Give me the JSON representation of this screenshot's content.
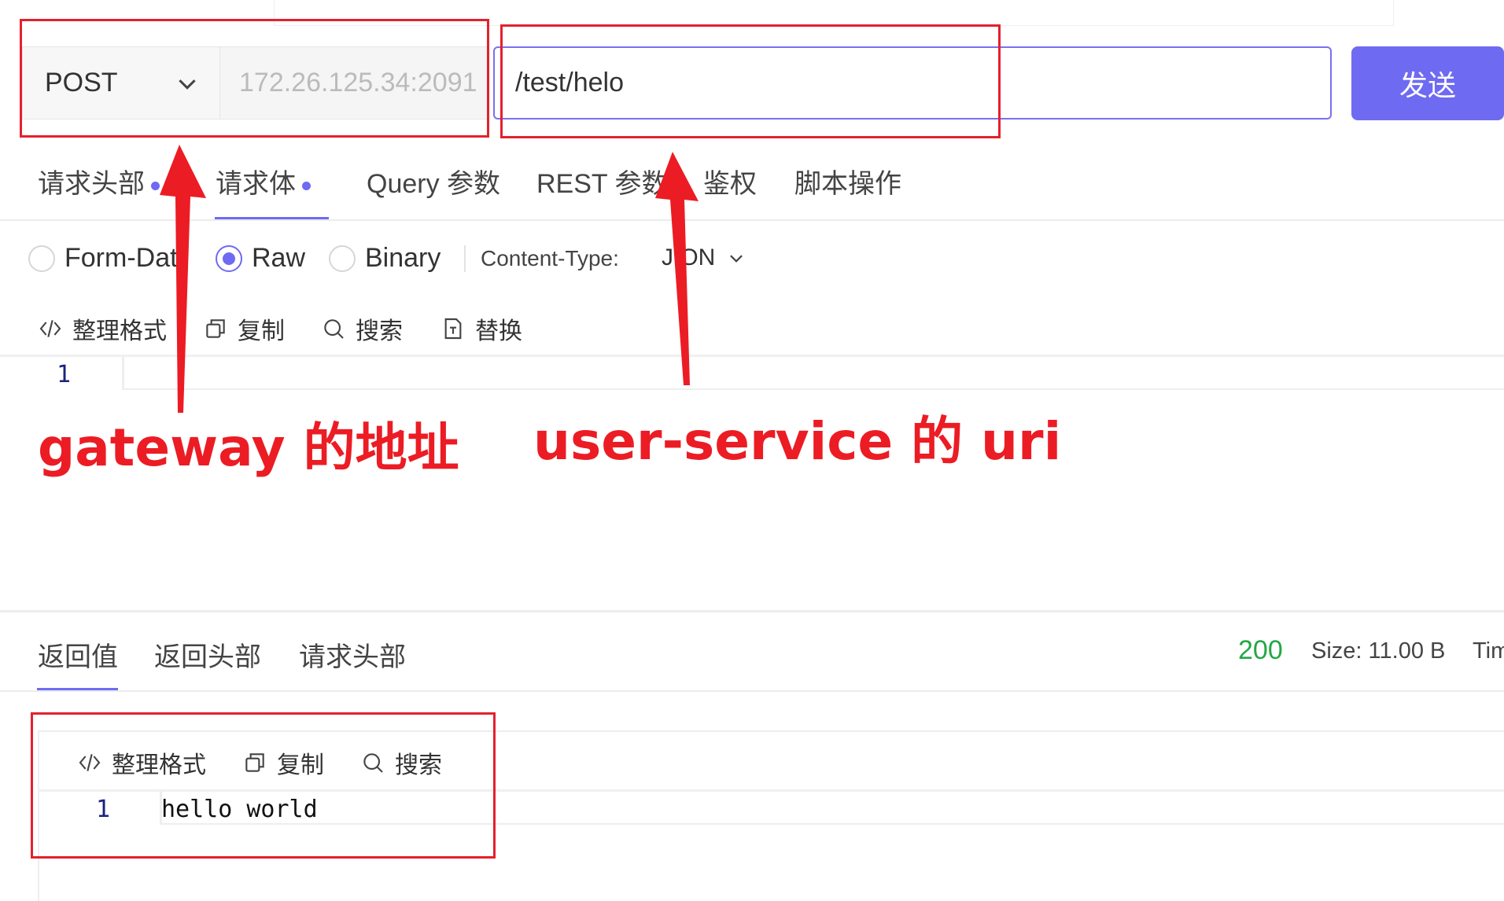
{
  "request": {
    "method": "POST",
    "host": "172.26.125.34:2091",
    "path": "/test/helo",
    "send_label": "发送"
  },
  "request_tabs": [
    "请求头部",
    "请求体",
    "Query 参数",
    "REST 参数",
    "鉴权",
    "脚本操作"
  ],
  "body_types": [
    "Form-Dat",
    "Raw",
    "Binary"
  ],
  "content_type": {
    "label": "Content-Type:",
    "value": "J  ON"
  },
  "editor_tools": [
    "整理格式",
    "复制",
    "搜索",
    "替换"
  ],
  "request_editor": {
    "line": "1"
  },
  "response_tabs": [
    "返回值",
    "返回头部",
    "请求头部"
  ],
  "response_status": {
    "code": "200",
    "size": "Size: 11.00 B",
    "time": "Tim"
  },
  "response_tools": [
    "整理格式",
    "复制",
    "搜索"
  ],
  "response_editor": {
    "line": "1",
    "content": "hello world"
  },
  "annotations": {
    "gateway": "gateway 的地址",
    "user_service": "user-service 的 uri"
  },
  "colors": {
    "accent": "#6f6af2",
    "annotation": "#e5202e",
    "success": "#22a845"
  }
}
